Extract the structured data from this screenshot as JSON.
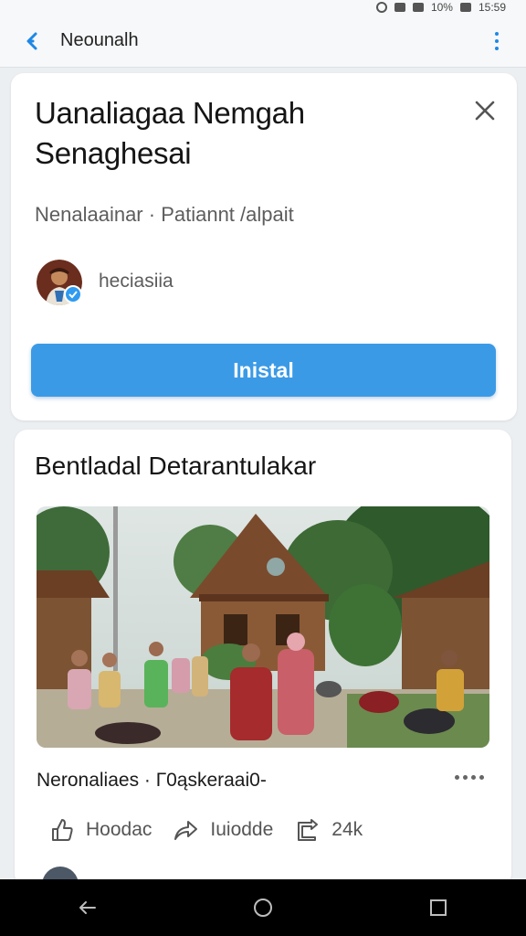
{
  "status_bar": {
    "battery": "10%",
    "time": "15:59"
  },
  "app_bar": {
    "title": "Neounalh"
  },
  "app_card": {
    "name": "Uanaliagaa Nemgah Senaghesai",
    "meta": "Nenalaainar · Patiannt /alpait",
    "developer": "heciasiia",
    "install_label": "Inistal"
  },
  "post_card": {
    "title": "Bentladal Detarantulakar",
    "caption": "Neronaliaes · Г0ąskeraai0-",
    "actions": [
      {
        "label": "Hoodac",
        "icon": "thumbs-up-icon"
      },
      {
        "label": "Iuiodde",
        "icon": "share-icon"
      },
      {
        "label": "24k",
        "icon": "repost-icon"
      }
    ]
  },
  "colors": {
    "accent": "#3b9ae6",
    "nav": "#000000",
    "background": "#eceff2"
  }
}
